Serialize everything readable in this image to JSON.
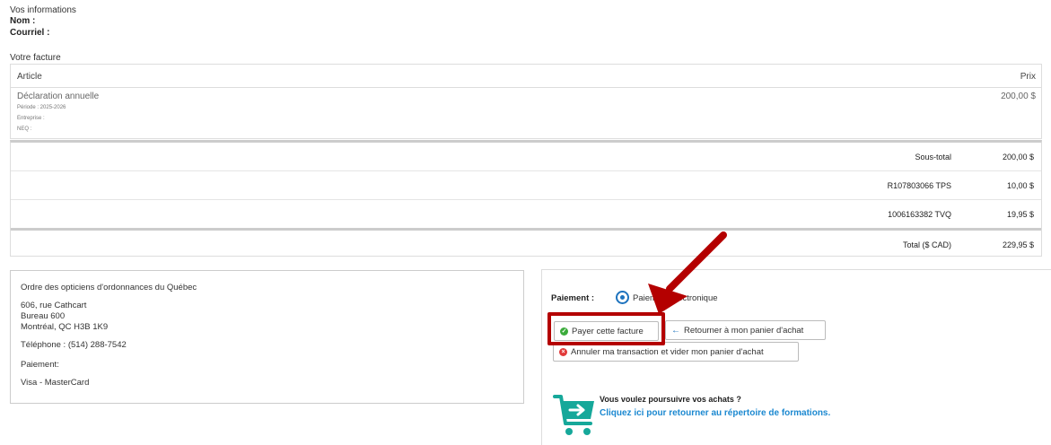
{
  "info": {
    "title": "Vos informations",
    "nom_label": "Nom :",
    "courriel_label": "Courriel :"
  },
  "invoice": {
    "title": "Votre facture",
    "col_article": "Article",
    "col_price": "Prix",
    "item": {
      "name": "Déclaration annuelle",
      "periode": "Période : 2025-2026",
      "entreprise": "Entreprise :",
      "neq": "NEQ :",
      "price": "200,00 $"
    },
    "totals": [
      {
        "label": "Sous-total",
        "value": "200,00 $"
      },
      {
        "label": "R107803066 TPS",
        "value": "10,00 $"
      },
      {
        "label": "1006163382 TVQ",
        "value": "19,95 $"
      },
      {
        "label": "Total ($ CAD)",
        "value": "229,95 $"
      }
    ]
  },
  "address": {
    "org": "Ordre des opticiens d'ordonnances du Québec",
    "street": "606, rue Cathcart",
    "suite": "Bureau 600",
    "city": "Montréal, QC H3B 1K9",
    "phone": "Téléphone : (514) 288-7542",
    "payment_label": "Paiement:",
    "payment_methods": "Visa - MasterCard"
  },
  "payment": {
    "label": "Paiement :",
    "option": "Paiement électronique",
    "btn_pay": "Payer cette facture",
    "btn_return": "Retourner à mon panier d'achat",
    "btn_cancel": "Annuler ma transaction et vider mon panier d'achat",
    "promo_title": "Vous voulez poursuivre vos achats ?",
    "promo_link": "Cliquez ici pour retourner au répertoire de formations."
  },
  "icons": {
    "check": "check-circle-icon",
    "arrow_left": "arrow-left-icon",
    "cancel": "x-circle-icon",
    "cart": "cart-arrow-icon"
  },
  "colors": {
    "accent": "#1e73be",
    "link": "#1b88d0",
    "annotation": "#b40000",
    "cart": "#16a89a",
    "success": "#3bab3b",
    "danger": "#e23a3a"
  }
}
